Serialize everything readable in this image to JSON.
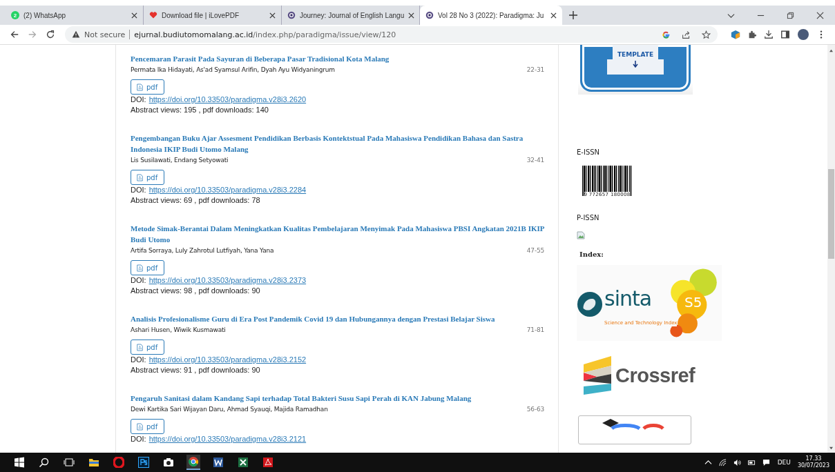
{
  "tabs": [
    {
      "title": "(2) WhatsApp",
      "badge": "2",
      "selected": false
    },
    {
      "title": "Download file | iLovePDF",
      "selected": false
    },
    {
      "title": "Journey: Journal of English Langu",
      "selected": false
    },
    {
      "title": "Vol 28 No 3 (2022): Paradigma: Ju",
      "selected": true
    }
  ],
  "address_bar": {
    "security": "Not secure",
    "domain": "ejurnal.budiutomomalang.ac.id",
    "path": "/index.php/paradigma/issue/view/120"
  },
  "articles": [
    {
      "title": "Pencemaran Parasit Pada Sayuran di Beberapa Pasar Tradisional Kota Malang",
      "authors": "Permata Ika Hidayati, As'ad Syamsul Arifin, Dyah Ayu Widyaningrum",
      "pages": "22-31",
      "button": "pdf",
      "doi_label": "DOI:",
      "doi": "https://doi.org/10.33503/paradigma.v28i3.2620",
      "stats": "Abstract views: 195 , pdf downloads: 140"
    },
    {
      "title": "Pengembangan Buku Ajar Assesment Pendidikan Berbasis Kontektstual Pada Mahasiswa Pendidikan Bahasa dan Sastra Indonesia IKIP Budi Utomo Malang",
      "authors": "Lis Susilawati, Endang Setyowati",
      "pages": "32-41",
      "button": "pdf",
      "doi_label": "DOI:",
      "doi": "https://doi.org/10.33503/paradigma.v28i3.2284",
      "stats": "Abstract views: 69 , pdf downloads: 78"
    },
    {
      "title": "Metode Simak-Berantai Dalam Meningkatkan Kualitas Pembelajaran Menyimak Pada Mahasiswa PBSI Angkatan 2021B IKIP Budi Utomo",
      "authors": "Artifa Sorraya, Luly Zahrotul Lutfiyah, Yana Yana",
      "pages": "47-55",
      "button": "pdf",
      "doi_label": "DOI:",
      "doi": "https://doi.org/10.33503/paradigma.v28i3.2373",
      "stats": "Abstract views: 98 , pdf downloads: 90"
    },
    {
      "title": "Analisis Profesionalisme Guru di Era Post Pandemik Covid 19 dan Hubungannya dengan Prestasi Belajar Siswa",
      "authors": "Ashari Husen, Wiwik Kusmawati",
      "pages": "71-81",
      "button": "pdf",
      "doi_label": "DOI:",
      "doi": "https://doi.org/10.33503/paradigma.v28i3.2152",
      "stats": "Abstract views: 91 , pdf downloads: 90"
    },
    {
      "title": "Pengaruh Sanitasi dalam Kandang Sapi terhadap Total Bakteri Susu Sapi Perah di KAN Jabung Malang",
      "authors": "Dewi Kartika Sari Wijayan Daru, Ahmad Syauqi, Majida Ramadhan",
      "pages": "56-63",
      "button": "pdf",
      "doi_label": "DOI:",
      "doi": "https://doi.org/10.33503/paradigma.v28i3.2121"
    }
  ],
  "sidebar": {
    "template_label": "TEMPLATE",
    "eissn_label": "E-ISSN",
    "barcode_digits": "9 772657 180008",
    "pissn_label": "P-ISSN",
    "index_label": "Index:",
    "sinta": {
      "wordmark": "sinta",
      "grade": "S5",
      "tagline": "Science and Technology Index"
    },
    "crossref": "Crossref"
  },
  "taskbar": {
    "language": "DEU",
    "time": "17.33",
    "date": "30/07/2023"
  }
}
